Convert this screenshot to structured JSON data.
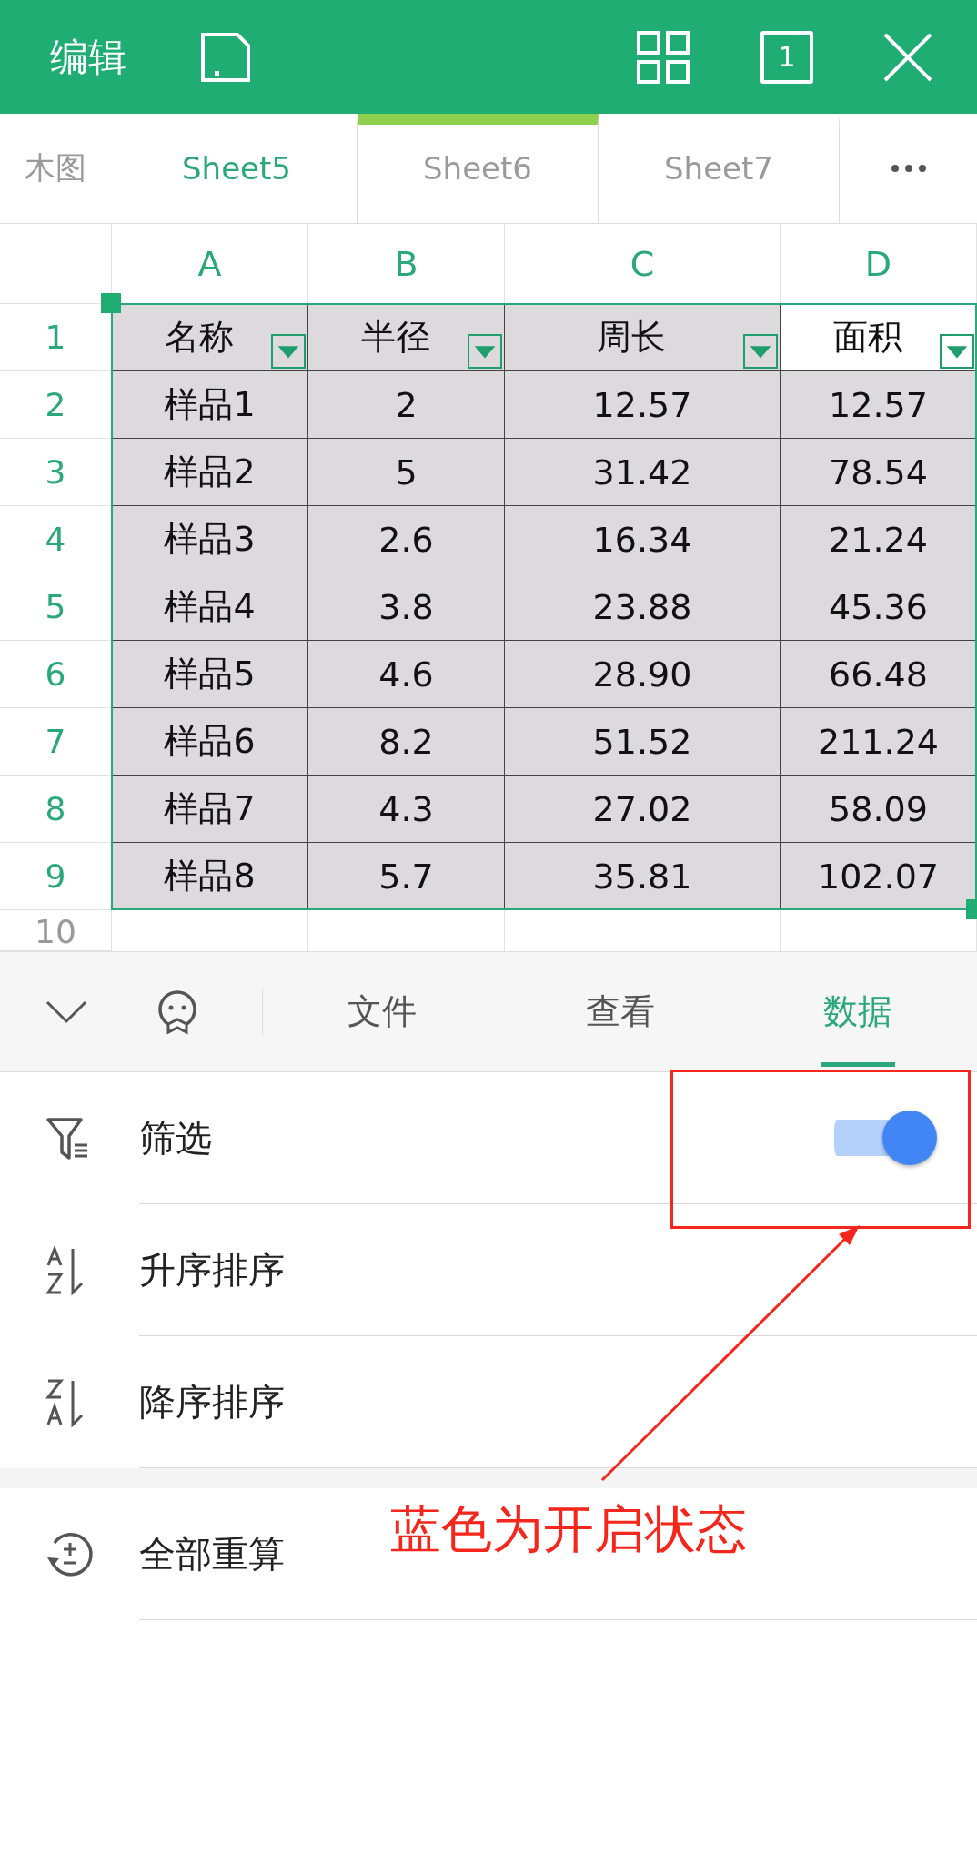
{
  "top_bar": {
    "title": "编辑",
    "page_count": "1"
  },
  "sheet_tabs": [
    {
      "label": "木图",
      "selected": false,
      "highlighted": false
    },
    {
      "label": "Sheet5",
      "selected": false,
      "highlighted": true
    },
    {
      "label": "Sheet6",
      "selected": true,
      "highlighted": false
    },
    {
      "label": "Sheet7",
      "selected": false,
      "highlighted": false
    }
  ],
  "table": {
    "columns": [
      "A",
      "B",
      "C",
      "D"
    ],
    "rows": [
      {
        "number": "1",
        "cells": [
          {
            "text": "名称",
            "filter": true,
            "active": false
          },
          {
            "text": "半径",
            "filter": true,
            "active": false
          },
          {
            "text": "周长",
            "filter": true,
            "active": false
          },
          {
            "text": "面积",
            "filter": true,
            "active": true
          }
        ]
      },
      {
        "number": "2",
        "cells": [
          "样品1",
          "2",
          "12.57",
          "12.57"
        ]
      },
      {
        "number": "3",
        "cells": [
          "样品2",
          "5",
          "31.42",
          "78.54"
        ]
      },
      {
        "number": "4",
        "cells": [
          "样品3",
          "2.6",
          "16.34",
          "21.24"
        ]
      },
      {
        "number": "5",
        "cells": [
          "样品4",
          "3.8",
          "23.88",
          "45.36"
        ]
      },
      {
        "number": "6",
        "cells": [
          "样品5",
          "4.6",
          "28.90",
          "66.48"
        ]
      },
      {
        "number": "7",
        "cells": [
          "样品6",
          "8.2",
          "51.52",
          "211.24"
        ]
      },
      {
        "number": "8",
        "cells": [
          "样品7",
          "4.3",
          "27.02",
          "58.09"
        ]
      },
      {
        "number": "9",
        "cells": [
          "样品8",
          "5.7",
          "35.81",
          "102.07"
        ]
      },
      {
        "number": "10",
        "cells": [
          "",
          "",
          "",
          ""
        ]
      }
    ]
  },
  "toolbar_tabs": [
    {
      "label": "文件",
      "selected": false
    },
    {
      "label": "查看",
      "selected": false
    },
    {
      "label": "数据",
      "selected": true
    }
  ],
  "panel": {
    "groups": [
      [
        {
          "kind": "toggle",
          "label": "筛选",
          "on": true
        },
        {
          "kind": "action",
          "label": "升序排序"
        },
        {
          "kind": "action",
          "label": "降序排序"
        }
      ],
      [
        {
          "kind": "action",
          "label": "全部重算"
        }
      ]
    ]
  },
  "annotation": {
    "text": "蓝色为开启状态"
  }
}
